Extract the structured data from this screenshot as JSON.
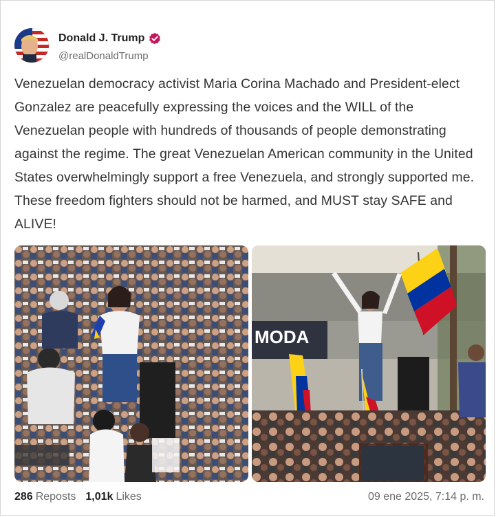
{
  "author": {
    "name": "Donald J. Trump",
    "handle": "@realDonaldTrump",
    "verified": true
  },
  "post": {
    "text": "Venezuelan democracy activist Maria Corina Machado and President-elect Gonzalez are peacefully expressing the voices and the WILL of the Venezuelan people with hundreds of thousands of people demonstrating against the regime. The great Venezuelan American community in the United States overwhelmingly support a free Venezuela, and strongly supported me. These freedom fighters should not be harmed, and MUST stay SAFE and ALIVE!"
  },
  "media": {
    "right_sign_text": "MODA"
  },
  "stats": {
    "reposts_count": "286",
    "reposts_label": "Reposts",
    "likes_count": "1,01k",
    "likes_label": "Likes"
  },
  "timestamp": "09 ene 2025, 7:14 p. m.",
  "colors": {
    "verified": "#c2185b",
    "text": "#333333",
    "muted": "#6b6b6b"
  }
}
